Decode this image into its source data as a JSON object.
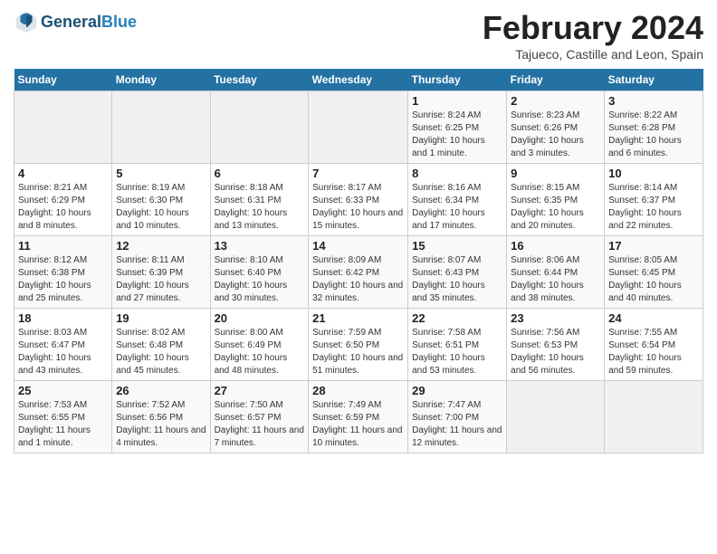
{
  "header": {
    "logo_general": "General",
    "logo_blue": "Blue",
    "month_title": "February 2024",
    "subtitle": "Tajueco, Castille and Leon, Spain"
  },
  "weekdays": [
    "Sunday",
    "Monday",
    "Tuesday",
    "Wednesday",
    "Thursday",
    "Friday",
    "Saturday"
  ],
  "weeks": [
    [
      {
        "day": "",
        "info": ""
      },
      {
        "day": "",
        "info": ""
      },
      {
        "day": "",
        "info": ""
      },
      {
        "day": "",
        "info": ""
      },
      {
        "day": "1",
        "info": "Sunrise: 8:24 AM\nSunset: 6:25 PM\nDaylight: 10 hours and 1 minute."
      },
      {
        "day": "2",
        "info": "Sunrise: 8:23 AM\nSunset: 6:26 PM\nDaylight: 10 hours and 3 minutes."
      },
      {
        "day": "3",
        "info": "Sunrise: 8:22 AM\nSunset: 6:28 PM\nDaylight: 10 hours and 6 minutes."
      }
    ],
    [
      {
        "day": "4",
        "info": "Sunrise: 8:21 AM\nSunset: 6:29 PM\nDaylight: 10 hours and 8 minutes."
      },
      {
        "day": "5",
        "info": "Sunrise: 8:19 AM\nSunset: 6:30 PM\nDaylight: 10 hours and 10 minutes."
      },
      {
        "day": "6",
        "info": "Sunrise: 8:18 AM\nSunset: 6:31 PM\nDaylight: 10 hours and 13 minutes."
      },
      {
        "day": "7",
        "info": "Sunrise: 8:17 AM\nSunset: 6:33 PM\nDaylight: 10 hours and 15 minutes."
      },
      {
        "day": "8",
        "info": "Sunrise: 8:16 AM\nSunset: 6:34 PM\nDaylight: 10 hours and 17 minutes."
      },
      {
        "day": "9",
        "info": "Sunrise: 8:15 AM\nSunset: 6:35 PM\nDaylight: 10 hours and 20 minutes."
      },
      {
        "day": "10",
        "info": "Sunrise: 8:14 AM\nSunset: 6:37 PM\nDaylight: 10 hours and 22 minutes."
      }
    ],
    [
      {
        "day": "11",
        "info": "Sunrise: 8:12 AM\nSunset: 6:38 PM\nDaylight: 10 hours and 25 minutes."
      },
      {
        "day": "12",
        "info": "Sunrise: 8:11 AM\nSunset: 6:39 PM\nDaylight: 10 hours and 27 minutes."
      },
      {
        "day": "13",
        "info": "Sunrise: 8:10 AM\nSunset: 6:40 PM\nDaylight: 10 hours and 30 minutes."
      },
      {
        "day": "14",
        "info": "Sunrise: 8:09 AM\nSunset: 6:42 PM\nDaylight: 10 hours and 32 minutes."
      },
      {
        "day": "15",
        "info": "Sunrise: 8:07 AM\nSunset: 6:43 PM\nDaylight: 10 hours and 35 minutes."
      },
      {
        "day": "16",
        "info": "Sunrise: 8:06 AM\nSunset: 6:44 PM\nDaylight: 10 hours and 38 minutes."
      },
      {
        "day": "17",
        "info": "Sunrise: 8:05 AM\nSunset: 6:45 PM\nDaylight: 10 hours and 40 minutes."
      }
    ],
    [
      {
        "day": "18",
        "info": "Sunrise: 8:03 AM\nSunset: 6:47 PM\nDaylight: 10 hours and 43 minutes."
      },
      {
        "day": "19",
        "info": "Sunrise: 8:02 AM\nSunset: 6:48 PM\nDaylight: 10 hours and 45 minutes."
      },
      {
        "day": "20",
        "info": "Sunrise: 8:00 AM\nSunset: 6:49 PM\nDaylight: 10 hours and 48 minutes."
      },
      {
        "day": "21",
        "info": "Sunrise: 7:59 AM\nSunset: 6:50 PM\nDaylight: 10 hours and 51 minutes."
      },
      {
        "day": "22",
        "info": "Sunrise: 7:58 AM\nSunset: 6:51 PM\nDaylight: 10 hours and 53 minutes."
      },
      {
        "day": "23",
        "info": "Sunrise: 7:56 AM\nSunset: 6:53 PM\nDaylight: 10 hours and 56 minutes."
      },
      {
        "day": "24",
        "info": "Sunrise: 7:55 AM\nSunset: 6:54 PM\nDaylight: 10 hours and 59 minutes."
      }
    ],
    [
      {
        "day": "25",
        "info": "Sunrise: 7:53 AM\nSunset: 6:55 PM\nDaylight: 11 hours and 1 minute."
      },
      {
        "day": "26",
        "info": "Sunrise: 7:52 AM\nSunset: 6:56 PM\nDaylight: 11 hours and 4 minutes."
      },
      {
        "day": "27",
        "info": "Sunrise: 7:50 AM\nSunset: 6:57 PM\nDaylight: 11 hours and 7 minutes."
      },
      {
        "day": "28",
        "info": "Sunrise: 7:49 AM\nSunset: 6:59 PM\nDaylight: 11 hours and 10 minutes."
      },
      {
        "day": "29",
        "info": "Sunrise: 7:47 AM\nSunset: 7:00 PM\nDaylight: 11 hours and 12 minutes."
      },
      {
        "day": "",
        "info": ""
      },
      {
        "day": "",
        "info": ""
      }
    ]
  ]
}
